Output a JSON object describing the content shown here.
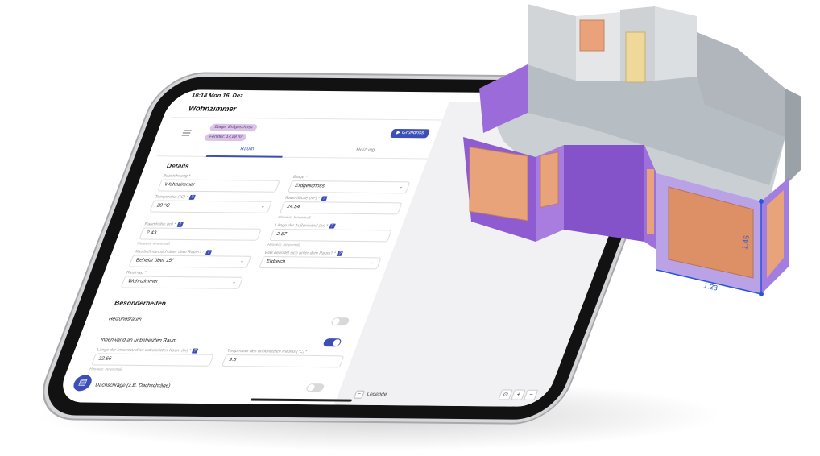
{
  "status": {
    "time": "10:18",
    "date": "Mon 16. Dez",
    "dots": "•••"
  },
  "page": {
    "title": "Wohnzimmer"
  },
  "chips": {
    "floor": "Etage: Erdgeschoss",
    "area": "Fenster: 14,88 m²"
  },
  "buttons": {
    "floorplan": "▶ Grundriss"
  },
  "tabs": {
    "room": "Raum",
    "heating": "Heizung"
  },
  "details": {
    "heading": "Details",
    "name": {
      "label": "Bezeichnung *",
      "value": "Wohnzimmer"
    },
    "floor": {
      "label": "Etage *",
      "value": "Erdgeschoss"
    },
    "temperature": {
      "label": "Temperatur (°C) *",
      "value": "20 °C"
    },
    "floor_area": {
      "label": "Raumfläche (m²) *",
      "value": "24.54",
      "hint": "Hinweis: Innenmaß"
    },
    "room_height": {
      "label": "Raumhöhe (m) *",
      "value": "2.43",
      "hint": "Hinweis: Innenmaß"
    },
    "outer_wall_length": {
      "label": "Länge der Außenwand (m) *",
      "value": "2.87",
      "hint": "Hinweis: Innenmaß"
    },
    "above": {
      "label": "Was befindet sich über dem Raum? *",
      "value": "Beheizt über 15°"
    },
    "below": {
      "label": "Was befindet sich unter dem Raum? *",
      "value": "Erdreich"
    },
    "room_type": {
      "label": "Raumtyp *",
      "value": "Wohnzimmer"
    }
  },
  "specials": {
    "heading": "Besonderheiten",
    "heating_room": {
      "label": "Heizungsraum"
    },
    "inner_wall": {
      "label": "Innenwand an unbeheizten Raum"
    },
    "wall_length": {
      "label": "Länge der Innenwand an unbeheizten Raum (m) *",
      "value": "22.66",
      "hint": "Hinweis: Innenmaß"
    },
    "unheated_temp": {
      "label": "Temperatur des unbeheizten Raums (°C) *",
      "value": "9.5"
    },
    "slope": {
      "label": "Dachschräge (z.B. Dachschräge)"
    }
  },
  "viewer": {
    "legend": "Legende",
    "zoom_fit": "⊙",
    "zoom_in": "+",
    "zoom_out": "−"
  },
  "model": {
    "dimension_v": "1.45",
    "dimension_h": "1.23"
  },
  "colors": {
    "accent": "#3c4fb8",
    "wall_purple": "#8e5bd1",
    "window_orange": "#e8a37a"
  }
}
